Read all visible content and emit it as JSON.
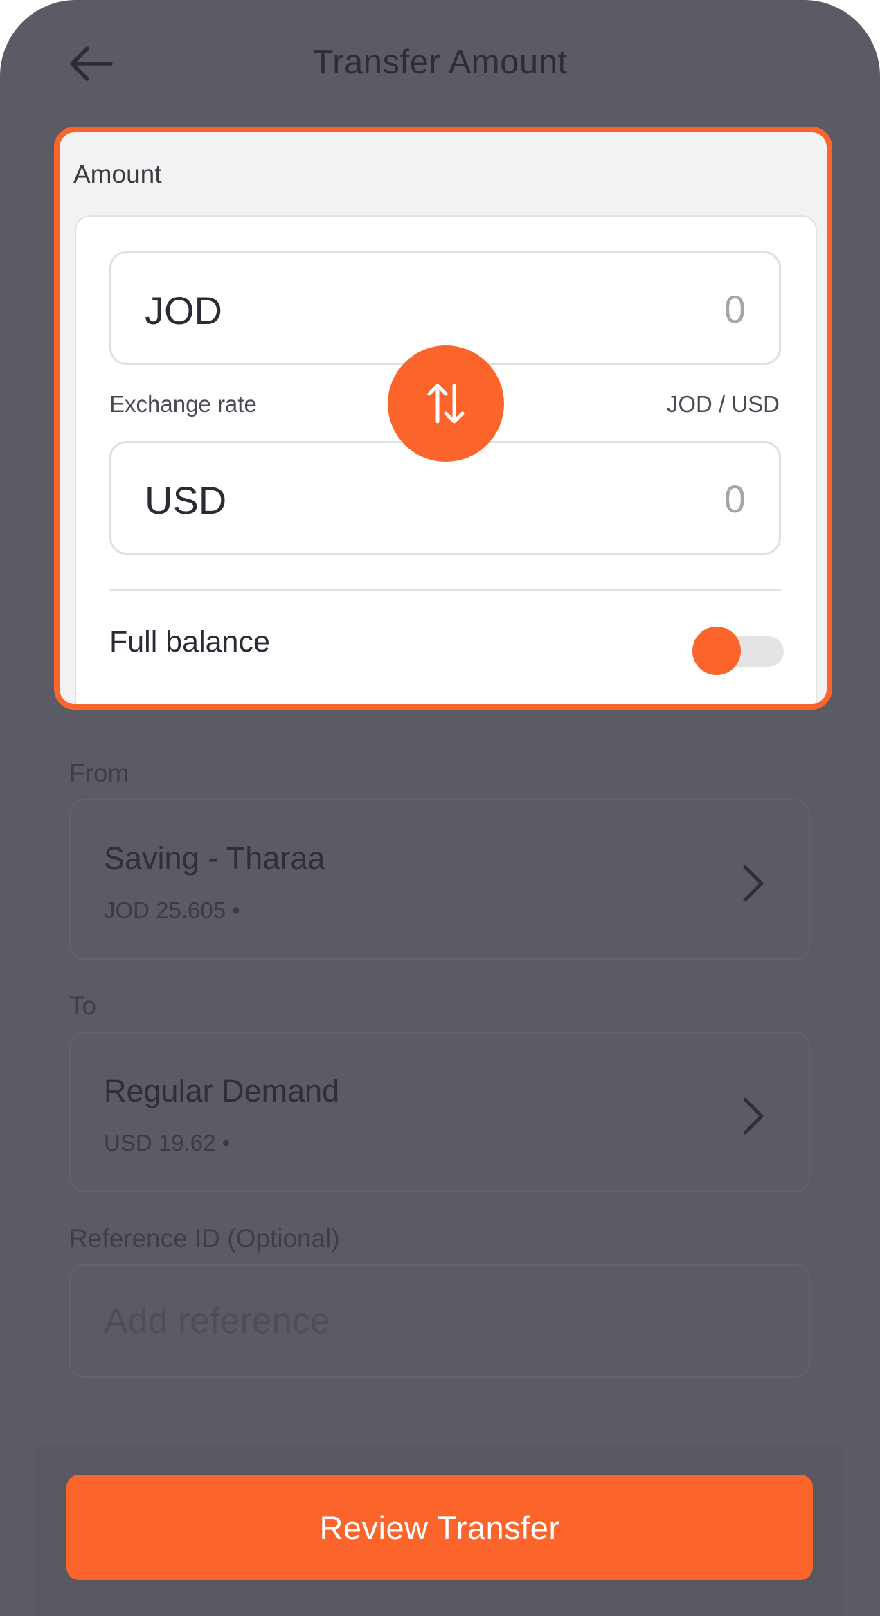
{
  "header": {
    "title": "Transfer Amount",
    "back_icon": "arrow-left-icon"
  },
  "amount": {
    "label": "Amount",
    "from_currency": {
      "code": "JOD",
      "value": "0"
    },
    "to_currency": {
      "code": "USD",
      "value": "0"
    },
    "exchange_rate_label": "Exchange rate",
    "exchange_rate_pair": "JOD / USD",
    "swap_icon": "swap-vertical-icon",
    "full_balance_label": "Full balance",
    "full_balance_on": false
  },
  "from": {
    "label": "From",
    "account_name": "Saving - Tharaa",
    "balance": "JOD 25.605  •"
  },
  "to": {
    "label": "To",
    "account_name": "Regular Demand",
    "balance": "USD 19.62  •"
  },
  "reference": {
    "label": "Reference ID (Optional)",
    "placeholder": "Add reference"
  },
  "review_button": "Review Transfer",
  "colors": {
    "accent": "#fb652b",
    "overlay": "#5b5b66"
  }
}
